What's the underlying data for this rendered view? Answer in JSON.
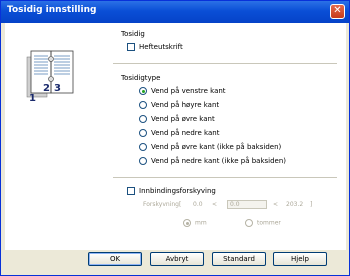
{
  "window": {
    "title": "Tosidig innstilling"
  },
  "sections": {
    "duplex": {
      "heading": "Tosidig",
      "booklet_label": "Hefteutskrift",
      "booklet_checked": false
    },
    "duplex_type": {
      "heading": "Tosidigtype",
      "options": [
        {
          "label": "Vend på venstre kant",
          "selected": true
        },
        {
          "label": "Vend på høyre kant",
          "selected": false
        },
        {
          "label": "Vend på øvre kant",
          "selected": false
        },
        {
          "label": "Vend på nedre kant",
          "selected": false
        },
        {
          "label": "Vend på øvre kant (ikke på baksiden)",
          "selected": false
        },
        {
          "label": "Vend på nedre kant (ikke på baksiden)",
          "selected": false
        }
      ]
    },
    "binding_offset": {
      "label": "Innbindingsforskyving",
      "checked": false,
      "offset_label": "Forskyvning[",
      "min": "0.0",
      "min_sep": "<",
      "value": "0.0",
      "max_sep": "<",
      "max": "203.2",
      "close_bracket": "]",
      "units": [
        {
          "label": "mm",
          "selected": true
        },
        {
          "label": "tommer",
          "selected": false
        }
      ]
    }
  },
  "preview": {
    "page_left": "2",
    "page_right": "3",
    "page_front": "1"
  },
  "buttons": {
    "ok": "OK",
    "cancel": "Avbryt",
    "default": "Standard",
    "help": "Hjelp"
  },
  "colors": {
    "title_bar": "#0a4fd6",
    "radio_selected": "#21a121",
    "dialog_bg": "#ece9d8"
  }
}
